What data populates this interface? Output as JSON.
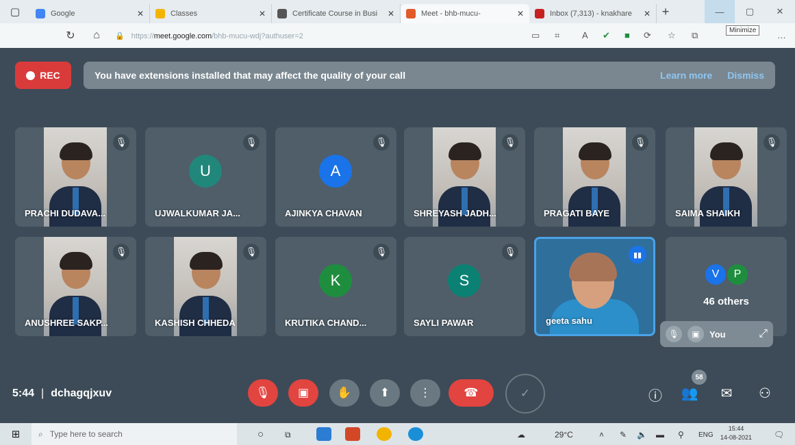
{
  "browser": {
    "tabs": [
      {
        "label": "Google",
        "color": "#4285f4"
      },
      {
        "label": "Classes",
        "color": "#f2b400"
      },
      {
        "label": "Certificate Course in Busi",
        "color": "#555555"
      },
      {
        "label": "Meet - bhb-mucu-",
        "color": "#e05a2a"
      },
      {
        "label": "Inbox (7,313) - knakhare",
        "color": "#c5221f"
      }
    ],
    "url_prefix": "https://",
    "url_host": "meet.google.com",
    "url_path": "/bhb-mucu-wdj?authuser=2",
    "tooltip": "Minimize"
  },
  "meet": {
    "rec_label": "REC",
    "banner_message": "You have extensions installed that may affect the quality of your call",
    "banner_learn_more": "Learn more",
    "banner_dismiss": "Dismiss",
    "participants": [
      {
        "name": "PRACHI DUDAVA...",
        "type": "photo",
        "initial": ""
      },
      {
        "name": "UJWALKUMAR JA...",
        "type": "avatar",
        "initial": "U",
        "color": "#21877a"
      },
      {
        "name": "AJINKYA CHAVAN",
        "type": "avatar",
        "initial": "A",
        "color": "#1a73e8"
      },
      {
        "name": "SHREYASH JADH...",
        "type": "photo",
        "initial": ""
      },
      {
        "name": "PRAGATI BAYE",
        "type": "photo",
        "initial": ""
      },
      {
        "name": "SAIMA SHAIKH",
        "type": "photo",
        "initial": ""
      },
      {
        "name": "ANUSHREE SAKP...",
        "type": "photo",
        "initial": ""
      },
      {
        "name": "KASHISH CHHEDA",
        "type": "photo",
        "initial": ""
      },
      {
        "name": "KRUTIKA CHAND...",
        "type": "avatar",
        "initial": "K",
        "color": "#1e8e3e"
      },
      {
        "name": "SAYLI PAWAR",
        "type": "avatar",
        "initial": "S",
        "color": "#0b8174"
      },
      {
        "name": "geeta sahu",
        "type": "speaking",
        "initial": ""
      }
    ],
    "others": {
      "initials": [
        "V",
        "P"
      ],
      "colors": [
        "#1a73e8",
        "#1e8e3e"
      ],
      "label": "46 others"
    },
    "self_label": "You",
    "time": "5:44",
    "meeting_code": "dchagqjxuv",
    "people_count": "58"
  },
  "taskbar": {
    "search_placeholder": "Type here to search",
    "temperature": "29°C",
    "language": "ENG",
    "time": "15:44",
    "date": "14-08-2021"
  }
}
